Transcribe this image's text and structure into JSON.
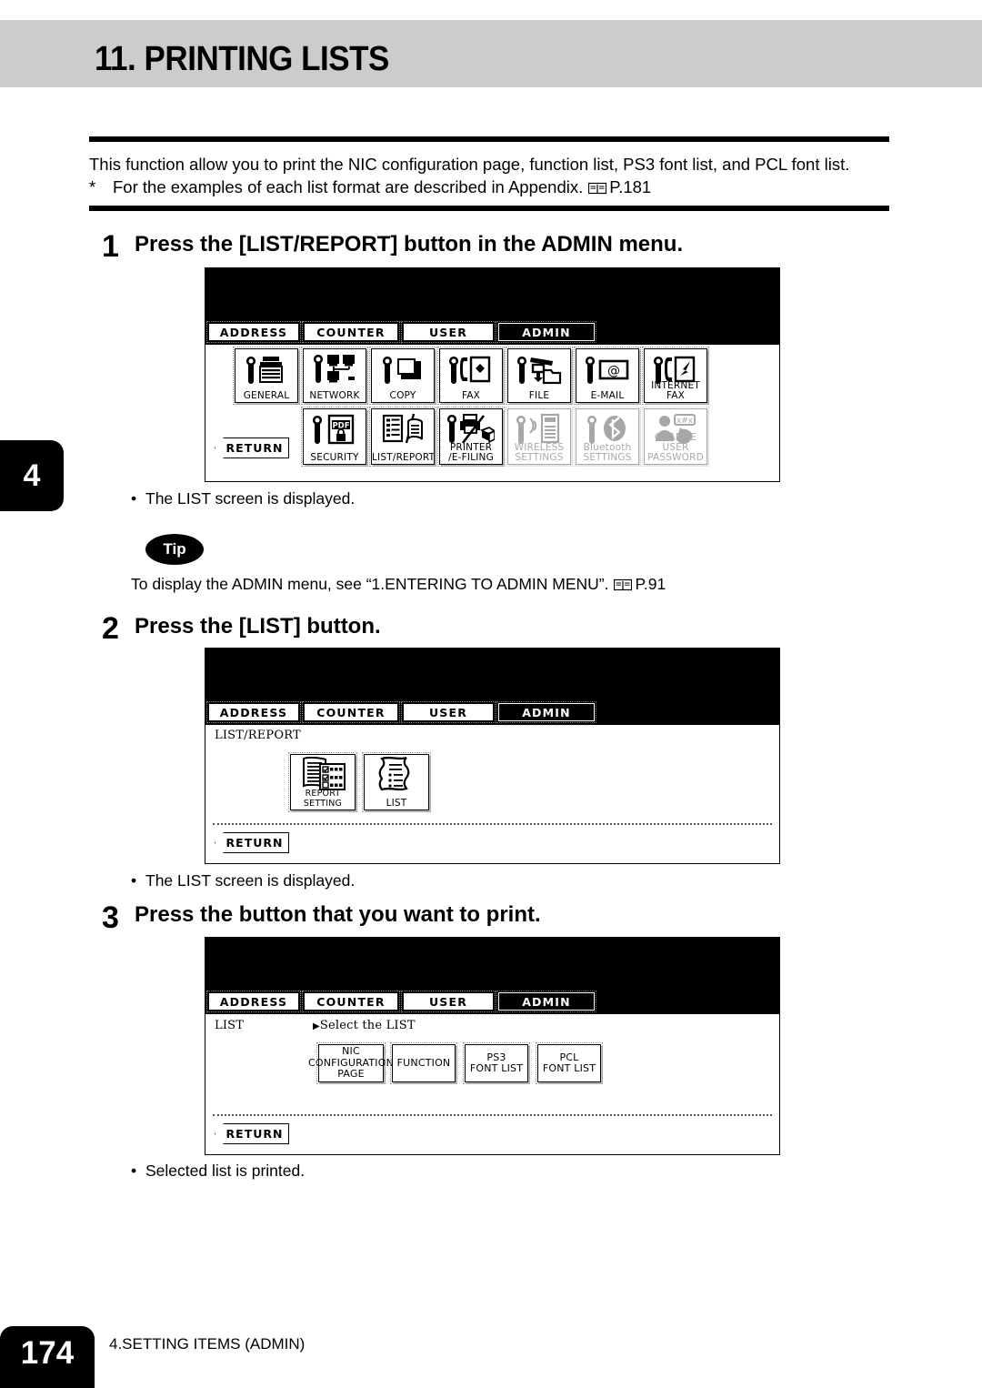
{
  "header": {
    "title": "11. PRINTING LISTS",
    "band_color": "#cccccc"
  },
  "intro": {
    "line1": "This function allow you to print the NIC configuration page, function list, PS3 font list, and PCL font list.",
    "asterisk": "*",
    "line2": "For the examples of each list format are described in Appendix.",
    "line2_ref": "P.181"
  },
  "chapter_marker": "4",
  "footer": {
    "page_number": "174",
    "chapter_title": "4.SETTING ITEMS (ADMIN)"
  },
  "steps": [
    {
      "number": "1",
      "title": "Press the [LIST/REPORT] button in the ADMIN menu.",
      "note": "The LIST screen is displayed."
    },
    {
      "number": "2",
      "title": "Press the [LIST] button.",
      "note": "The LIST screen is displayed."
    },
    {
      "number": "3",
      "title": "Press the button that you want to print.",
      "note": "Selected list is printed."
    }
  ],
  "tip": {
    "badge": "Tip",
    "text": "To display the ADMIN menu, see “1.ENTERING TO ADMIN MENU”.",
    "ref": "P.91"
  },
  "lcd_tabs": [
    {
      "label": "ADDRESS",
      "active": false
    },
    {
      "label": "COUNTER",
      "active": false
    },
    {
      "label": "USER",
      "active": false
    },
    {
      "label": "ADMIN",
      "active": true
    }
  ],
  "screen_admin": {
    "return_label": "RETURN",
    "row1": [
      {
        "label": "GENERAL",
        "icon": "wrench-copier-icon",
        "dim": false
      },
      {
        "label": "NETWORK",
        "icon": "wrench-network-icon",
        "dim": false
      },
      {
        "label": "COPY",
        "icon": "wrench-page-icon",
        "dim": false
      },
      {
        "label": "FAX",
        "icon": "wrench-fax-icon",
        "dim": false
      },
      {
        "label": "FILE",
        "icon": "wrench-file-folder-icon",
        "dim": false
      },
      {
        "label": "E-MAIL",
        "icon": "wrench-envelope-at-icon",
        "dim": false
      },
      {
        "label": "INTERNET FAX",
        "icon": "wrench-internet-fax-icon",
        "dim": false
      }
    ],
    "row2": [
      {
        "label": "SECURITY",
        "icon": "wrench-pdf-lock-icon",
        "dim": false
      },
      {
        "label": "LIST/REPORT",
        "icon": "list-report-icon",
        "dim": false
      },
      {
        "label": "PRINTER\n/E-FILING",
        "icon": "wrench-printer-efiling-icon",
        "dim": false
      },
      {
        "label": "WIRELESS\nSETTINGS",
        "icon": "wrench-wireless-icon",
        "dim": true
      },
      {
        "label": "Bluetooth\nSETTINGS",
        "icon": "wrench-bluetooth-icon",
        "dim": true
      },
      {
        "label": "CHANGE USER\nPASSWORD",
        "icon": "change-user-password-icon",
        "dim": true
      }
    ]
  },
  "screen_listreport": {
    "breadcrumb": "LIST/REPORT",
    "return_label": "RETURN",
    "buttons": [
      {
        "label": "REPORT SETTING",
        "icon": "report-setting-icon"
      },
      {
        "label": "LIST",
        "icon": "list-icon"
      }
    ]
  },
  "screen_list": {
    "breadcrumb": "LIST",
    "prompt_arrow": "▶",
    "prompt": "Select the LIST",
    "return_label": "RETURN",
    "buttons": [
      {
        "label": "NIC\nCONFIGURATION\nPAGE"
      },
      {
        "label": "FUNCTION"
      },
      {
        "label": "PS3\nFONT LIST"
      },
      {
        "label": "PCL\nFONT LIST"
      }
    ]
  }
}
